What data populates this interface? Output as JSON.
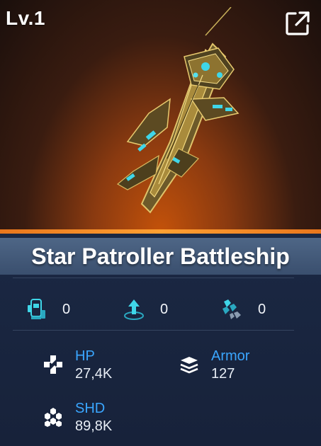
{
  "header": {
    "level": "Lv.1",
    "share_icon": "external-link-icon"
  },
  "ship": {
    "name": "Star Patroller Battleship",
    "image": "battleship-illustration"
  },
  "colors": {
    "accent_orange": "#f08a24",
    "label_blue": "#3aa6ff",
    "icon_cyan": "#3fd6e8"
  },
  "stats": [
    {
      "icon": "capsule-module-icon",
      "value": "0"
    },
    {
      "icon": "upgrade-arrow-icon",
      "value": "0"
    },
    {
      "icon": "drone-cluster-icon",
      "value": "0"
    }
  ],
  "attributes": {
    "hp": {
      "label": "HP",
      "value": "27,4K",
      "icon": "cross-plus-icon"
    },
    "armor": {
      "label": "Armor",
      "value": "127",
      "icon": "layers-icon"
    },
    "shd": {
      "label": "SHD",
      "value": "89,8K",
      "icon": "hexagon-cluster-icon"
    }
  }
}
